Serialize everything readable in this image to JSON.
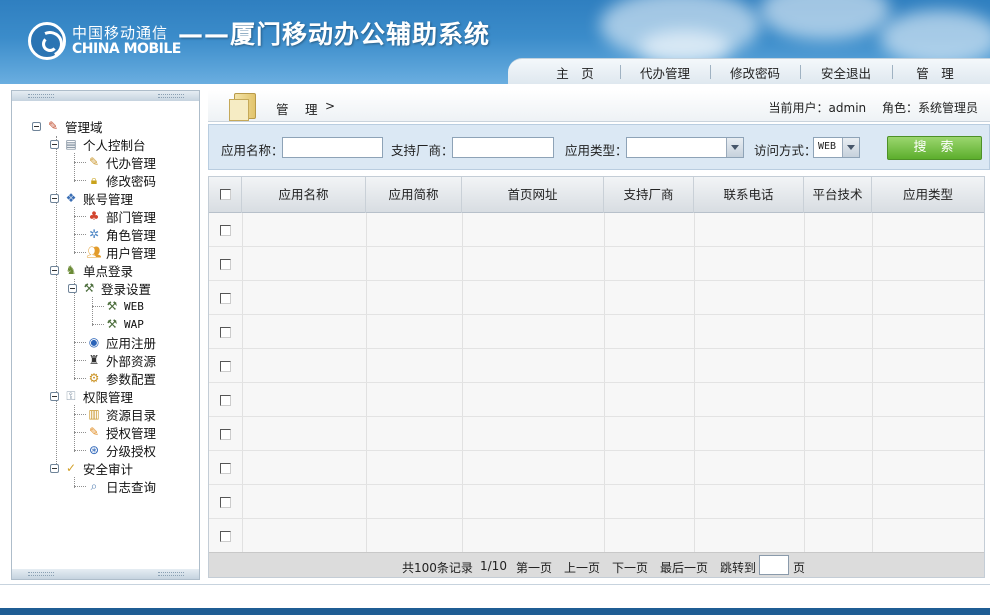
{
  "header": {
    "logo_cn": "中国移动通信",
    "logo_en": "CHINA MOBILE",
    "title": "——厦门移动办公辅助系统",
    "nav": [
      {
        "label": "主　页"
      },
      {
        "label": "代办管理"
      },
      {
        "label": "修改密码"
      },
      {
        "label": "安全退出"
      },
      {
        "label": "管　理"
      }
    ]
  },
  "sidebar": {
    "tree": [
      {
        "label": "管理域",
        "icon": "admin-domain-icon"
      },
      {
        "label": "个人控制台",
        "icon": "console-icon"
      },
      {
        "label": "代办管理",
        "icon": "todo-icon"
      },
      {
        "label": "修改密码",
        "icon": "lock-icon"
      },
      {
        "label": "账号管理",
        "icon": "accounts-icon"
      },
      {
        "label": "部门管理",
        "icon": "department-icon"
      },
      {
        "label": "角色管理",
        "icon": "role-icon"
      },
      {
        "label": "用户管理",
        "icon": "users-icon"
      },
      {
        "label": "单点登录",
        "icon": "sso-icon"
      },
      {
        "label": "登录设置",
        "icon": "login-settings-icon"
      },
      {
        "label": "WEB",
        "icon": "web-icon"
      },
      {
        "label": "WAP",
        "icon": "wap-icon"
      },
      {
        "label": "应用注册",
        "icon": "app-register-icon"
      },
      {
        "label": "外部资源",
        "icon": "external-resource-icon"
      },
      {
        "label": "参数配置",
        "icon": "parameter-config-icon"
      },
      {
        "label": "权限管理",
        "icon": "permission-icon"
      },
      {
        "label": "资源目录",
        "icon": "resource-directory-icon"
      },
      {
        "label": "授权管理",
        "icon": "authorization-icon"
      },
      {
        "label": "分级授权",
        "icon": "hierarchical-auth-icon"
      },
      {
        "label": "安全审计",
        "icon": "security-audit-icon"
      },
      {
        "label": "日志查询",
        "icon": "log-search-icon"
      }
    ]
  },
  "crumb": {
    "label": "管　理",
    "arrow": ">"
  },
  "user": {
    "current_user_label": "当前用户：admin",
    "role_label": "角色：系统管理员"
  },
  "search": {
    "app_name_label": "应用名称：",
    "app_name_value": "",
    "vendor_label": "支持厂商：",
    "vendor_value": "",
    "app_type_label": "应用类型：",
    "app_type_value": "",
    "access_label": "访问方式：",
    "access_value": "WEB",
    "button_label": "搜索"
  },
  "table": {
    "columns": [
      "应用名称",
      "应用简称",
      "首页网址",
      "支持厂商",
      "联系电话",
      "平台技术",
      "应用类型"
    ],
    "row_count": 10
  },
  "pager": {
    "total": "共100条记录",
    "page": "1/10",
    "first": "第一页",
    "prev": "上一页",
    "next": "下一页",
    "last": "最后一页",
    "jump_label": "跳转到",
    "jump_value": "",
    "page_unit": "页"
  },
  "colors": {
    "header_blue": "#3b8cca",
    "search_green": "#6bbd3a",
    "search_bar_bg": "#dbe8f4",
    "footer_blue": "#1f5d94"
  }
}
